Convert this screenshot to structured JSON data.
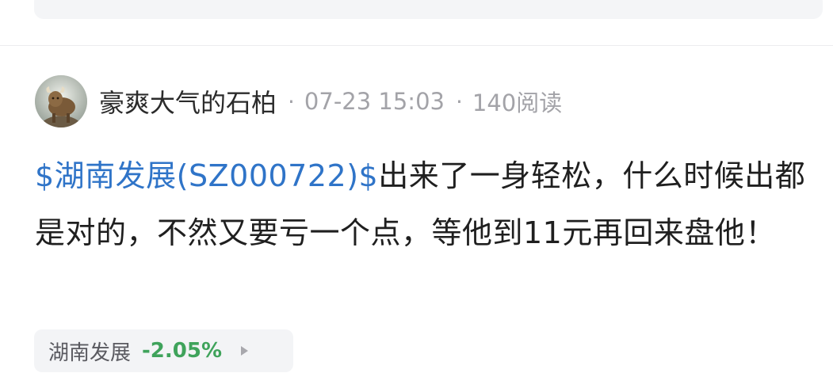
{
  "post": {
    "author": "豪爽大气的石柏",
    "avatar_icon": "bull-avatar-icon",
    "separator": "·",
    "timestamp": "07-23 15:03",
    "reads": "140阅读",
    "content": {
      "stock_link": "$湖南发展(SZ000722)$",
      "body": "出来了一身轻松，什么时候出都是对的，不然又要亏一个点，等他到11元再回来盘他！"
    },
    "stock_tag": {
      "name": "湖南发展",
      "change": "-2.05%",
      "change_color": "#3fa35b",
      "arrow_icon": "play-arrow-icon"
    }
  },
  "colors": {
    "link": "#2f74c8",
    "text": "#1f1f1f",
    "meta": "#a3a3a8",
    "chip_bg": "#f3f4f6"
  }
}
